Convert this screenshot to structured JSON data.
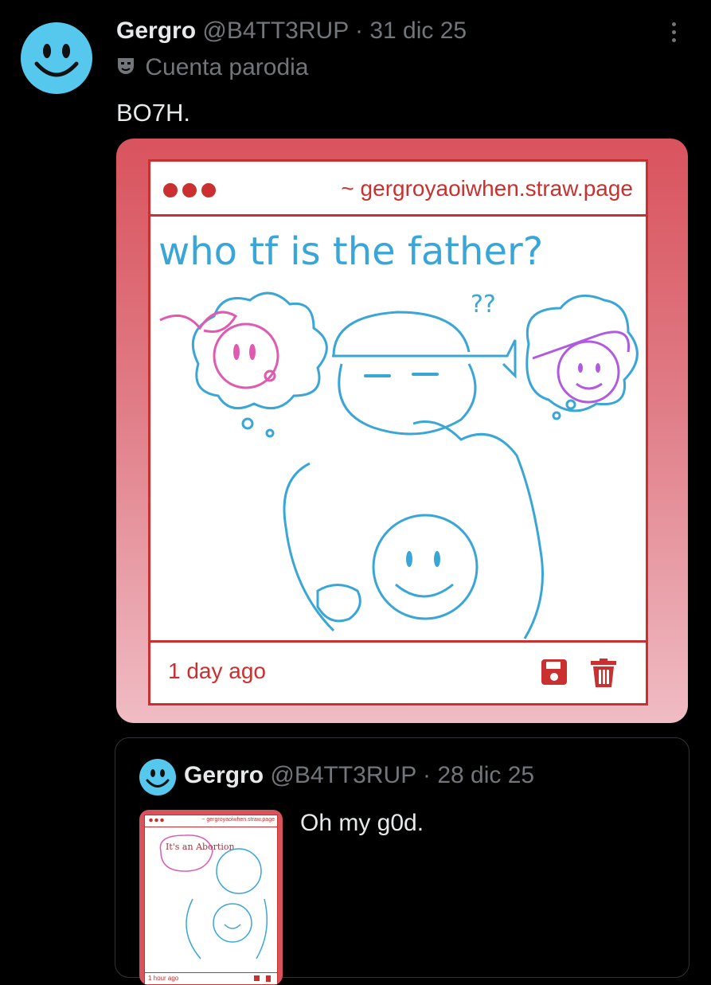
{
  "post": {
    "display_name": "Gergro",
    "handle": "@B4TT3RUP",
    "separator": "·",
    "date": "31 dic 25",
    "label_icon": "theater-masks-icon",
    "label": "Cuenta parodia",
    "text": "BO7H.",
    "more_icon": "more-vertical-icon"
  },
  "card": {
    "url": "~ gergroyaoiwhen.straw.page",
    "drawing_caption": "who tf is the father?",
    "drawing_marks": "??",
    "time": "1 day ago",
    "icons": [
      "save-icon",
      "trash-icon"
    ],
    "colors": {
      "frame": "#c9302f",
      "ink_blue": "#3aa6d8",
      "ink_pink": "#e05bb0",
      "ink_purple": "#b05ae0"
    }
  },
  "quoted": {
    "display_name": "Gergro",
    "handle": "@B4TT3RUP",
    "separator": "·",
    "date": "28 dic 25",
    "text": "Oh my g0d.",
    "thumb": {
      "url": "~ gergroyaoiwhen.straw.page",
      "caption": "It's an Abortion",
      "time": "1 hour ago"
    }
  }
}
